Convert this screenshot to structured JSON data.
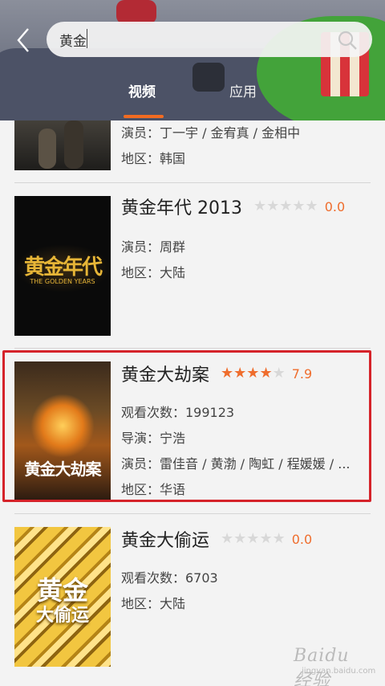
{
  "search": {
    "query": "黄金"
  },
  "tabs": [
    {
      "label": "视频",
      "active": true
    },
    {
      "label": "应用",
      "active": false
    }
  ],
  "colors": {
    "accent": "#ef6d2d",
    "highlight": "#d5232a"
  },
  "results": [
    {
      "actors": "演员：丁一宇 / 金宥真 / 金相中",
      "region": "地区：韩国"
    },
    {
      "title": "黄金年代 2013",
      "stars": 0,
      "rating": "0.0",
      "actors": "演员：周群",
      "region": "地区：大陆",
      "poster_text": "黄金年代",
      "poster_subtext": "THE GOLDEN YEARS"
    },
    {
      "title": "黄金大劫案",
      "stars": 4,
      "rating": "7.9",
      "views": "观看次数：199123",
      "director": "导演：宁浩",
      "actors": "演员：雷佳音 / 黄渤 / 陶虹 / 程媛媛 / ...",
      "region": "地区：华语",
      "poster_text": "黄金大劫案"
    },
    {
      "title": "黄金大偷运",
      "stars": 0,
      "rating": "0.0",
      "views": "观看次数：6703",
      "region": "地区：大陆",
      "poster_text": "黄金",
      "poster_text2": "大偷运"
    }
  ],
  "watermark": {
    "main": "Baidu经验",
    "sub": "jingyan.baidu.com"
  }
}
